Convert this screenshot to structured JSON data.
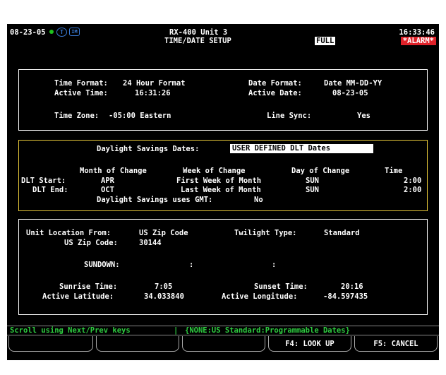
{
  "header": {
    "date": "08-23-05",
    "unit_line1": "RX-400 Unit 3",
    "unit_line2": "TIME/DATE SETUP",
    "mode_badge": "FULL",
    "time": "16:33:46",
    "alarm": "*ALARM*",
    "icon1": "T",
    "icon2": "IM"
  },
  "timebox": {
    "time_format_label": "Time Format:",
    "time_format_value": "24 Hour Format",
    "date_format_label": "Date Format:",
    "date_format_value": "Date MM-DD-YY",
    "active_time_label": "Active Time:",
    "active_time_value": "16:31:26",
    "active_date_label": "Active Date:",
    "active_date_value": "08-23-05",
    "time_zone_label": "Time Zone:",
    "time_zone_value": "-05:00 Eastern",
    "line_sync_label": "Line Sync:",
    "line_sync_value": "Yes"
  },
  "dlt": {
    "dates_label": "Daylight Savings Dates:",
    "dates_value": "USER DEFINED DLT Dates",
    "col_month": "Month of Change",
    "col_week": "Week of Change",
    "col_day": "Day of Change",
    "col_time": "Time",
    "start_label": "DLT Start:",
    "start_month": "APR",
    "start_week": "First Week of Month",
    "start_day": "SUN",
    "start_time": "2:00",
    "end_label": "DLT End:",
    "end_month": "OCT",
    "end_week": "Last Week of Month",
    "end_day": "SUN",
    "end_time": "2:00",
    "gmt_label": "Daylight Savings uses GMT:",
    "gmt_value": "No"
  },
  "location": {
    "from_label": "Unit Location From:",
    "from_value": "US Zip Code",
    "twilight_label": "Twilight Type:",
    "twilight_value": "Standard",
    "zip_label": "US Zip Code:",
    "zip_value": "30144",
    "sundown_label": "SUNDOWN:",
    "sundown_sep1": ":",
    "sundown_sep2": ":",
    "sunrise_label": "Sunrise Time:",
    "sunrise_value": "7:05",
    "sunset_label": "Sunset Time:",
    "sunset_value": "20:16",
    "lat_label": "Active Latitude:",
    "lat_value": "34.033840",
    "lon_label": "Active Longitude:",
    "lon_value": "-84.597435"
  },
  "status": {
    "scroll_hint": "Scroll using Next/Prev keys",
    "separator": "|",
    "options": "{NONE:US Standard:Programmable Dates}"
  },
  "fkeys": {
    "f4": "F4: LOOK UP",
    "f5": "F5: CANCEL"
  }
}
